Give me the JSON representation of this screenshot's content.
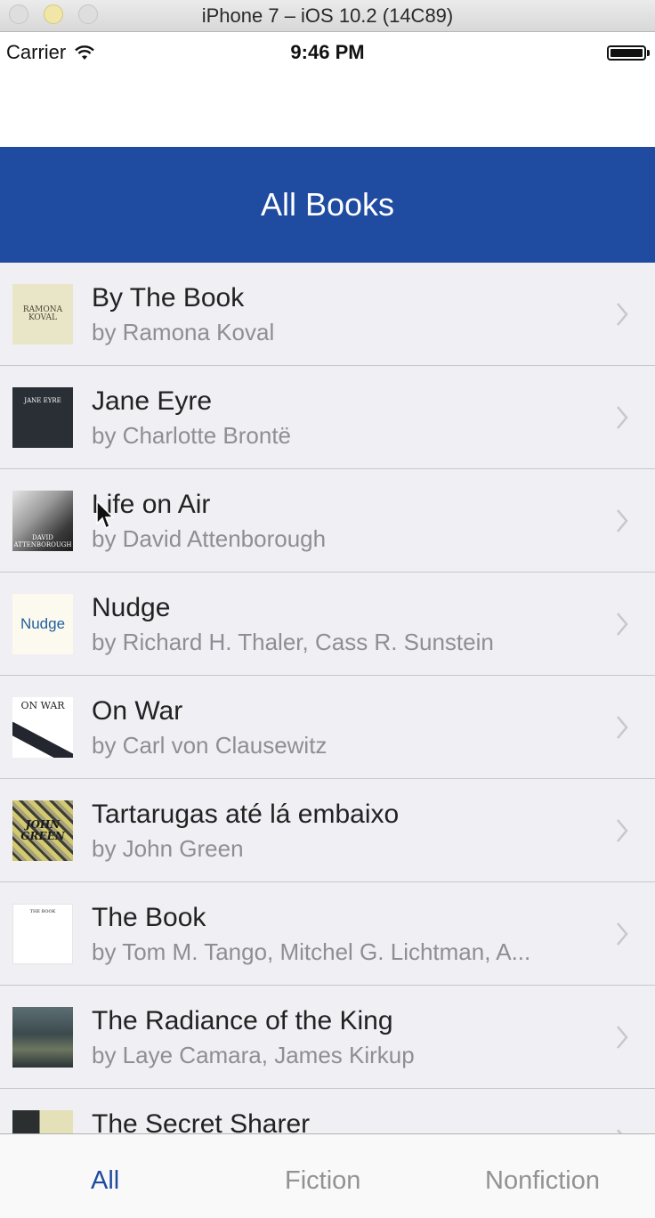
{
  "window": {
    "title": "iPhone 7 – iOS 10.2 (14C89)"
  },
  "status_bar": {
    "carrier": "Carrier",
    "time": "9:46 PM"
  },
  "nav": {
    "title": "All Books"
  },
  "books": [
    {
      "title": "By The Book",
      "author": "by Ramona Koval",
      "cover_text": "RAMONA KOVAL"
    },
    {
      "title": "Jane Eyre",
      "author": "by Charlotte Brontë",
      "cover_text": "JANE EYRE"
    },
    {
      "title": "Life on Air",
      "author": "by David Attenborough",
      "cover_text": "DAVID ATTENBOROUGH"
    },
    {
      "title": "Nudge",
      "author": "by Richard H. Thaler, Cass R. Sunstein",
      "cover_text": "Nudge"
    },
    {
      "title": "On War",
      "author": "by Carl von Clausewitz",
      "cover_text": "ON WAR"
    },
    {
      "title": "Tartarugas até lá embaixo",
      "author": "by John Green",
      "cover_text": "JOHN GREEN"
    },
    {
      "title": "The Book",
      "author": "by Tom M. Tango, Mitchel G. Lichtman, A...",
      "cover_text": "THE BOOK"
    },
    {
      "title": "The Radiance of the King",
      "author": "by Laye Camara, James Kirkup",
      "cover_text": ""
    },
    {
      "title": "The Secret Sharer",
      "author": "",
      "cover_text": ""
    }
  ],
  "tabs": [
    {
      "label": "All",
      "active": true
    },
    {
      "label": "Fiction",
      "active": false
    },
    {
      "label": "Nonfiction",
      "active": false
    }
  ],
  "colors": {
    "nav_bar": "#1f4ba0",
    "active_tab": "#1f4ba0",
    "inactive_tab": "#929292",
    "subtitle": "#8e8e93"
  },
  "icons": [
    "wifi-icon",
    "battery-icon",
    "chevron-right-icon",
    "mouse-cursor-icon"
  ]
}
